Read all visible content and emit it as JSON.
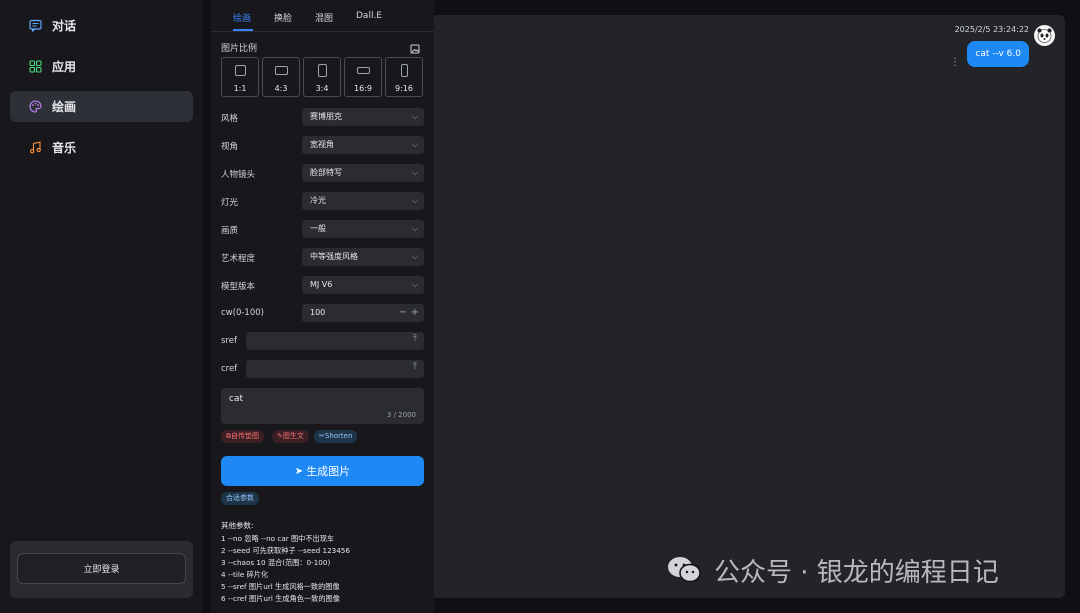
{
  "nav": {
    "items": [
      {
        "label": "对话",
        "icon": "chat-icon"
      },
      {
        "label": "应用",
        "icon": "grid-icon"
      },
      {
        "label": "绘画",
        "icon": "palette-icon"
      },
      {
        "label": "音乐",
        "icon": "music-icon"
      }
    ],
    "active": "绘画",
    "login_label": "立即登录"
  },
  "panel": {
    "tabs": [
      "绘画",
      "换脸",
      "混图",
      "Dall.E"
    ],
    "active_tab": "绘画",
    "ratio_title": "图片比例",
    "ratios": [
      "1:1",
      "4:3",
      "3:4",
      "16:9",
      "9:16"
    ],
    "rows": [
      {
        "label": "风格",
        "value": "赛博朋克"
      },
      {
        "label": "视角",
        "value": "宽视角"
      },
      {
        "label": "人物镜头",
        "value": "脸部特写"
      },
      {
        "label": "灯光",
        "value": "冷光"
      },
      {
        "label": "画质",
        "value": "一般"
      },
      {
        "label": "艺术程度",
        "value": "中等强度风格"
      },
      {
        "label": "模型版本",
        "value": "MJ V6"
      }
    ],
    "cw": {
      "label": "cw(0-100)",
      "value": "100"
    },
    "sref_label": "sref",
    "cref_label": "cref",
    "prompt": {
      "value": "cat",
      "count": "3 / 2000"
    },
    "chips": [
      {
        "label": "自传垫图",
        "color": "#f87171"
      },
      {
        "label": "图生文",
        "color": "#f87171"
      },
      {
        "label": "Shorten",
        "color": "#93c5fd"
      }
    ],
    "generate_label": "生成图片",
    "combo_label": "合适参数",
    "help_title": "其他参数:",
    "help_lines": [
      "1 --no 忽略 --no car 图中不出现车",
      "2 --seed 可先获取种子 --seed 123456",
      "3 --chaos 10 混合(范围：0-100)",
      "4 --tile 碎片化",
      "5 --sref 图片url 生成风格一致的图像",
      "6 --cref 图片url 生成角色一致的图像"
    ]
  },
  "chat": {
    "timestamp": "2025/2/5 23:24:22",
    "message": "cat --v 6.0",
    "accent": "#1e88f5"
  },
  "watermark": "公众号 · 银龙的编程日记"
}
